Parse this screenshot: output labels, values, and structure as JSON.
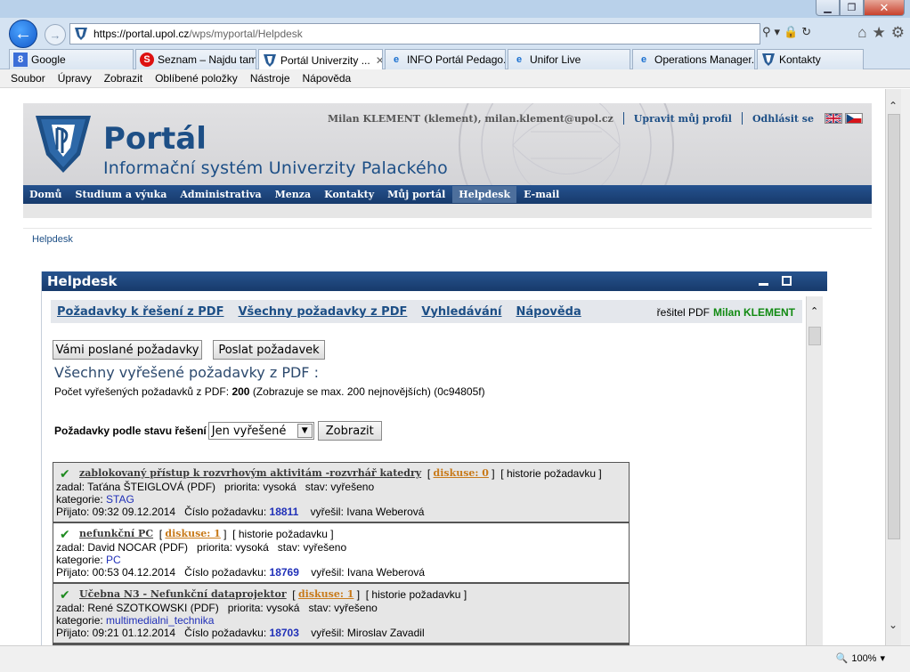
{
  "browser": {
    "window_buttons": {
      "min": "▁",
      "max": "❐",
      "close": "✕"
    },
    "address": {
      "proto": "https://",
      "host": "portal.upol.cz",
      "path": "/wps/myportal/Helpdesk"
    },
    "tabs": [
      {
        "label": "Google",
        "icon": "google-icon"
      },
      {
        "label": "Seznam – Najdu tam...",
        "icon": "seznam-icon"
      },
      {
        "label": "Portál Univerzity ...",
        "icon": "upol-icon",
        "active": true
      },
      {
        "label": "INFO Portál Pedago...",
        "icon": "ie-icon"
      },
      {
        "label": "Unifor Live",
        "icon": "ie-icon"
      },
      {
        "label": "Operations Manager...",
        "icon": "ie-icon"
      },
      {
        "label": "Kontakty",
        "icon": "upol-icon"
      }
    ],
    "menu": [
      "Soubor",
      "Úpravy",
      "Zobrazit",
      "Oblíbené položky",
      "Nástroje",
      "Nápověda"
    ],
    "zoom": "100%"
  },
  "portal": {
    "title": "Portál",
    "subtitle": "Informační systém Univerzity Palackého",
    "user": "Milan KLEMENT (klement), milan.klement@upol.cz",
    "edit_profile": "Upravit můj profil",
    "logout": "Odhlásit se",
    "nav": [
      "Domů",
      "Studium a výuka",
      "Administrativa",
      "Menza",
      "Kontakty",
      "Můj portál",
      "Helpdesk",
      "E-mail"
    ],
    "breadcrumb": "Helpdesk"
  },
  "helpdesk": {
    "title": "Helpdesk",
    "tabs": [
      "Požadavky k řešení z PDF",
      "Všechny požadavky z PDF",
      "Vyhledávání",
      "Nápověda"
    ],
    "solver_label": "řešitel PDF",
    "solver_name": "Milan KLEMENT",
    "btn_sent": "Vámi poslané požadavky",
    "btn_send": "Poslat požadavek",
    "section_title": "Všechny vyřešené požadavky z PDF :",
    "count_prefix": "Počet vyřešených požadavků z PDF:",
    "count_value": "200",
    "count_suffix": "(Zobrazuje se max. 200 nejnovějších) (0c94805f)",
    "filter_label": "Požadavky podle stavu řešení",
    "filter_value": "Jen vyřešené",
    "btn_show": "Zobrazit",
    "requests": [
      {
        "subject": "zablokovaný přístup k rozvrhovým aktivitám -rozvrhář katedry",
        "discussion": "diskuse: 0",
        "history": "historie požadavku",
        "author": "zadal: Taťána ŠTEIGLOVÁ (PDF)",
        "priority": "priorita: vysoká",
        "status": "stav: vyřešeno",
        "category_label": "kategorie:",
        "category": "STAG",
        "received": "Přijato: 09:32 09.12.2014",
        "number_label": "Číslo požadavku:",
        "number": "18811",
        "solver": "vyřešil: Ivana Weberová"
      },
      {
        "subject": "nefunkční PC",
        "discussion": "diskuse: 1",
        "history": "historie požadavku",
        "author": "zadal: David NOCAR (PDF)",
        "priority": "priorita: vysoká",
        "status": "stav: vyřešeno",
        "category_label": "kategorie:",
        "category": "PC",
        "received": "Přijato: 00:53 04.12.2014",
        "number_label": "Číslo požadavku:",
        "number": "18769",
        "solver": "vyřešil: Ivana Weberová"
      },
      {
        "subject": "Učebna N3 - Nefunkční dataprojektor",
        "discussion": "diskuse: 1",
        "history": "historie požadavku",
        "author": "zadal: René SZOTKOWSKI (PDF)",
        "priority": "priorita: vysoká",
        "status": "stav: vyřešeno",
        "category_label": "kategorie:",
        "category": "multimedialni_technika",
        "received": "Přijato: 09:21 01.12.2014",
        "number_label": "Číslo požadavku:",
        "number": "18703",
        "solver": "vyřešil: Miroslav Zavadil"
      }
    ]
  }
}
